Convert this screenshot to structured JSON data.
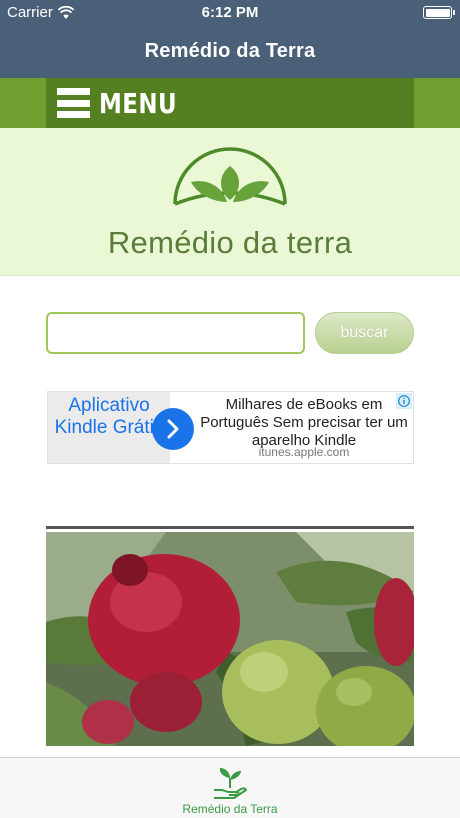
{
  "status_bar": {
    "carrier": "Carrier",
    "time": "6:12 PM"
  },
  "nav": {
    "title": "Remédio da Terra"
  },
  "menu": {
    "label": "MENU"
  },
  "logo": {
    "text": "Remédio da terra"
  },
  "search": {
    "value": "",
    "placeholder": "",
    "button_label": "buscar"
  },
  "ad": {
    "left_text": "Aplicativo Kindle Grátis",
    "headline": "Milhares de eBooks em Português Sem precisar ter um aparelho Kindle",
    "url": "itunes.apple.com"
  },
  "tab_bar": {
    "items": [
      {
        "label": "Remédio da Terra",
        "icon": "plant-icon"
      }
    ]
  },
  "colors": {
    "nav_bar": "#4a5f78",
    "menu_strip": "#6f9f2f",
    "menu_inner": "#548021",
    "banner": "#eaf8d6",
    "tab_active": "#3c9a45",
    "ad_accent": "#1a73e8"
  }
}
